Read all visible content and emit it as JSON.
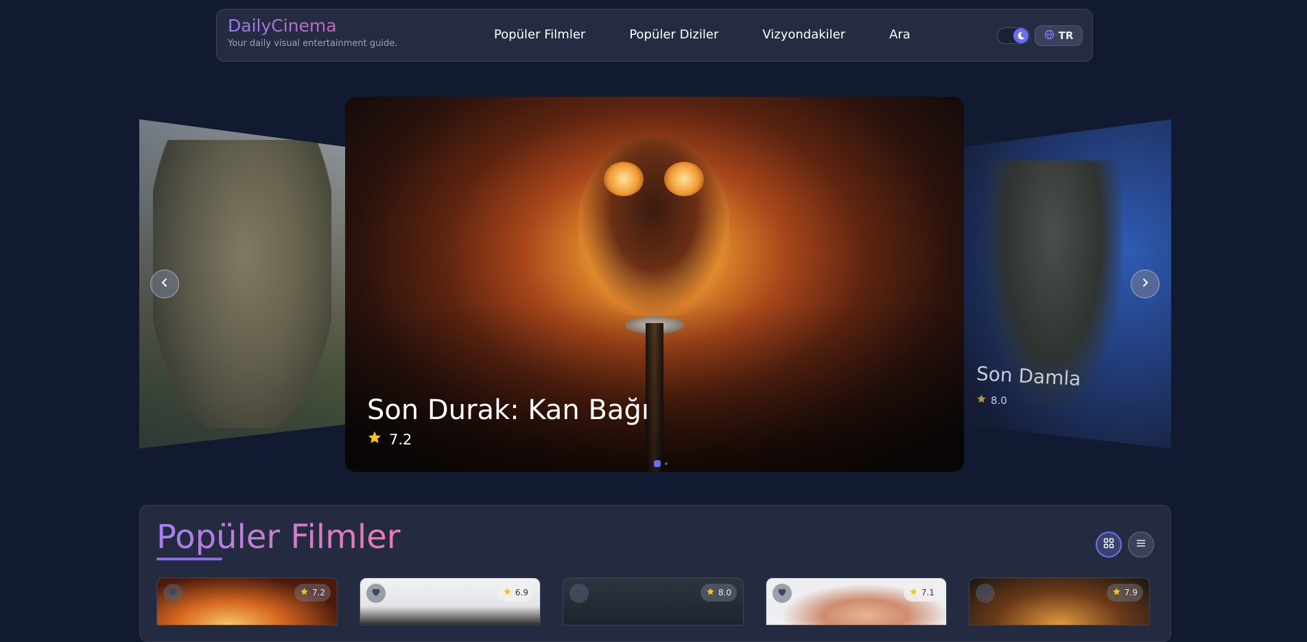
{
  "brand": {
    "name": "DailyCinema",
    "tagline": "Your daily visual entertainment guide."
  },
  "nav": {
    "links": [
      "Popüler Filmler",
      "Popüler Diziler",
      "Vizyondakiler",
      "Ara"
    ]
  },
  "header": {
    "language": "TR"
  },
  "carousel": {
    "main": {
      "title": "Son Durak: Kan Bağı",
      "rating": "7.2"
    },
    "right": {
      "title": "Son Damla",
      "rating": "8.0"
    }
  },
  "section": {
    "title": "Popüler Filmler",
    "cards": [
      {
        "rating": "7.2"
      },
      {
        "rating": "6.9"
      },
      {
        "rating": "8.0"
      },
      {
        "rating": "7.1"
      },
      {
        "rating": "7.9"
      }
    ]
  },
  "colors": {
    "accent": "#6b6ef2",
    "star": "#f5c518",
    "background": "#111a30"
  }
}
